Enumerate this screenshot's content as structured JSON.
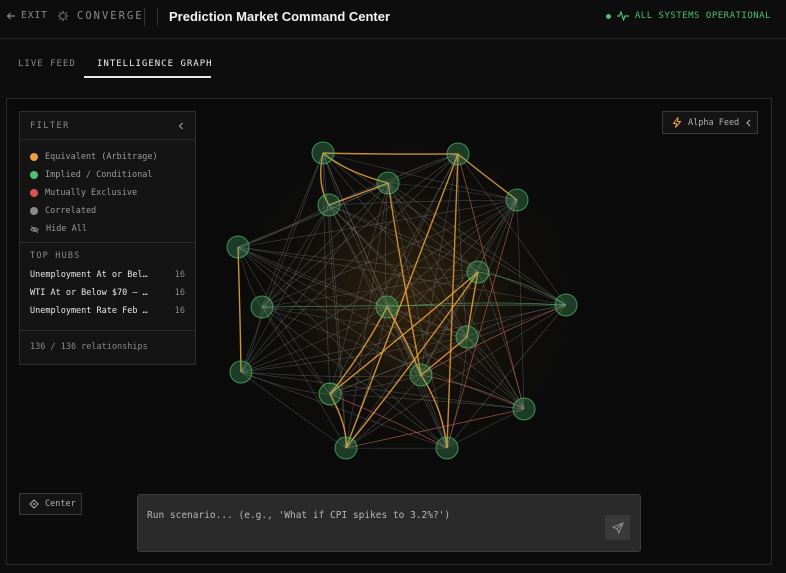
{
  "header": {
    "exit_label": "EXIT",
    "brand": "CONVERGE",
    "title": "Prediction Market Command Center",
    "status": "ALL SYSTEMS OPERATIONAL",
    "status_color": "#4fbf72"
  },
  "tabs": [
    {
      "label": "LIVE FEED",
      "active": false
    },
    {
      "label": "INTELLIGENCE GRAPH",
      "active": true
    }
  ],
  "filter": {
    "title": "FILTER",
    "legend": [
      {
        "label": "Equivalent (Arbitrage)",
        "color": "#e9a03b"
      },
      {
        "label": "Implied / Conditional",
        "color": "#4fbf72"
      },
      {
        "label": "Mutually Exclusive",
        "color": "#d9534f"
      },
      {
        "label": "Correlated",
        "color": "#8a8a8a"
      }
    ],
    "hide_all": "Hide All",
    "hubs_title": "TOP HUBS",
    "hubs": [
      {
        "name": "Unemployment At or Bel…",
        "count": "16"
      },
      {
        "name": "WTI At or Below $70 — …",
        "count": "16"
      },
      {
        "name": "Unemployment Rate Feb …",
        "count": "16"
      }
    ],
    "relationships": "136 / 136 relationships"
  },
  "alpha_feed": "Alpha Feed",
  "center_button": "Center",
  "scenario": {
    "placeholder": "Run scenario... (e.g., 'What if CPI spikes to 3.2%?')",
    "value": ""
  },
  "graph": {
    "node_color": "#4fbf72",
    "edge_colors": {
      "equivalent": "#e9a03b",
      "correlated": "#8a8a8a",
      "exclusive": "#d9534f",
      "implied": "#4fbf72"
    },
    "node_count": 18,
    "edge_count": 136
  }
}
